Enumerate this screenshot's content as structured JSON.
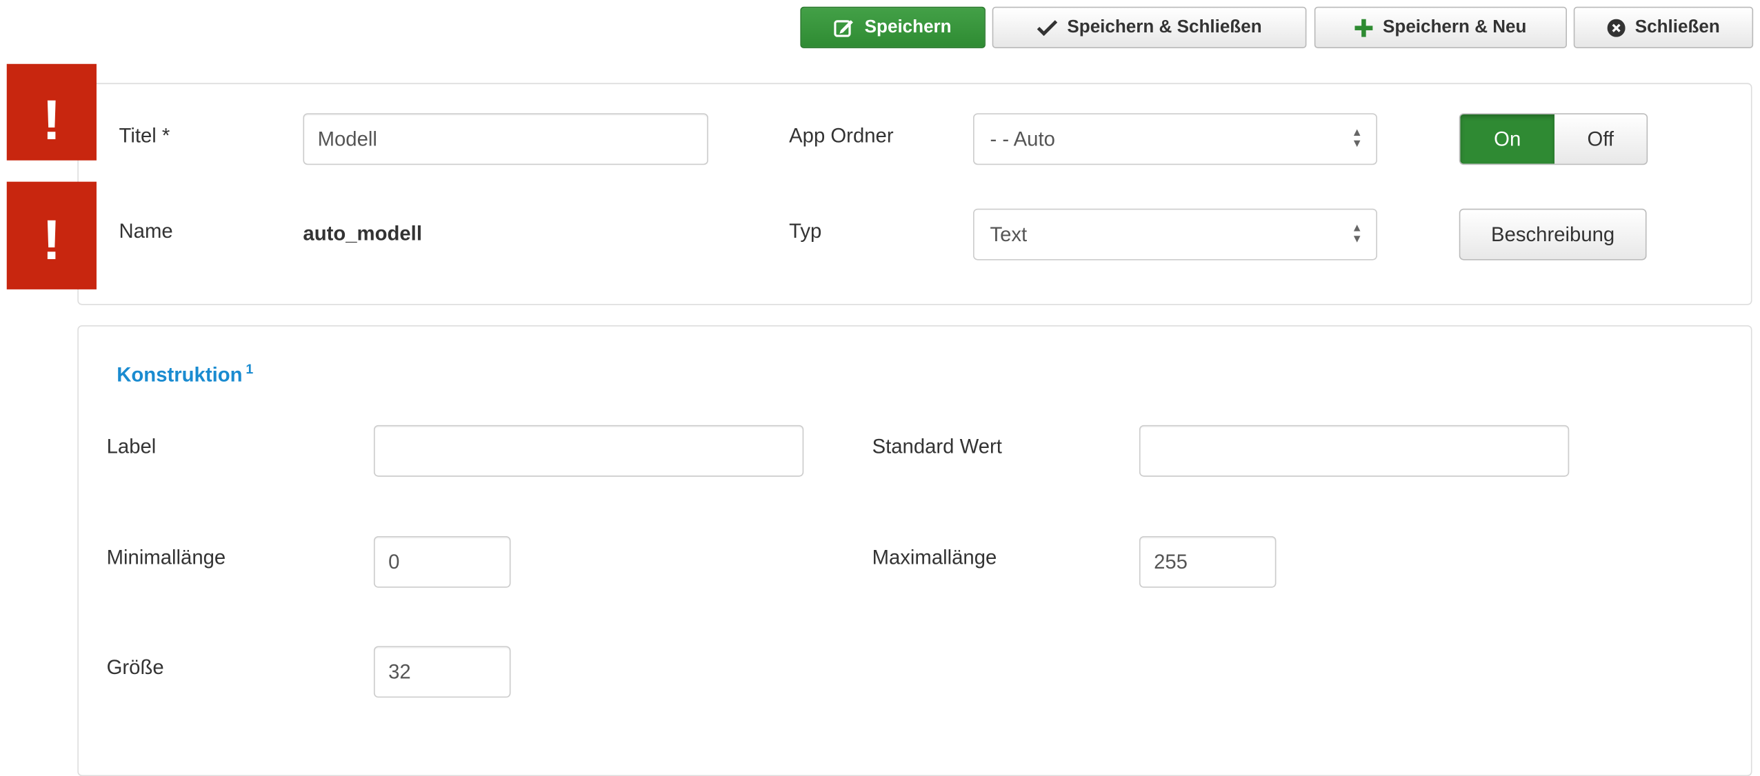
{
  "toolbar": {
    "save": "Speichern",
    "save_close": "Speichern & Schließen",
    "save_new": "Speichern & Neu",
    "close": "Schließen",
    "primary_color": "#3a9a3e"
  },
  "markers": {
    "symbol": "!",
    "color": "#c8260f"
  },
  "header_form": {
    "title_label": "Titel *",
    "title_value": "Modell",
    "name_label": "Name",
    "name_value": "auto_modell",
    "app_folder_label": "App Ordner",
    "app_folder_value": "- - Auto",
    "type_label": "Typ",
    "type_value": "Text",
    "toggle_on": "On",
    "toggle_off": "Off",
    "toggle_state": "On",
    "description_button": "Beschreibung"
  },
  "construction": {
    "title": "Konstruktion",
    "title_sup": "1",
    "label_label": "Label",
    "label_value": "",
    "default_label": "Standard Wert",
    "default_value": "",
    "minlength_label": "Minimallänge",
    "minlength_value": "0",
    "maxlength_label": "Maximallänge",
    "maxlength_value": "255",
    "size_label": "Größe",
    "size_value": "32"
  }
}
